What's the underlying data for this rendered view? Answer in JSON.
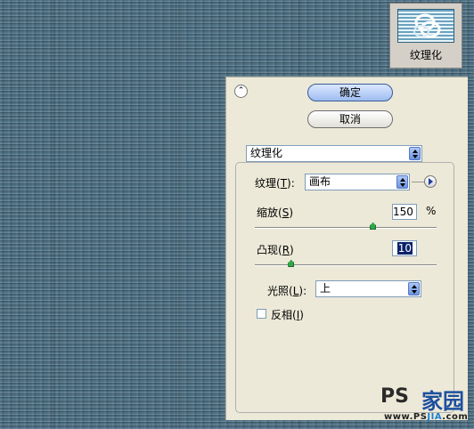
{
  "thumbnail": {
    "label": "纹理化"
  },
  "dialog": {
    "ok_label": "确定",
    "cancel_label": "取消",
    "collapse_glyph": "⌃",
    "filter_select_value": "纹理化",
    "texture": {
      "label": "纹理",
      "hotkey": "T",
      "value": "画布"
    },
    "scale": {
      "label": "缩放",
      "hotkey": "S",
      "value": "150",
      "unit": "%",
      "slider_fraction": 0.65
    },
    "relief": {
      "label": "凸现",
      "hotkey": "R",
      "value": "10",
      "slider_fraction": 0.2
    },
    "light": {
      "label": "光照",
      "hotkey": "L",
      "value": "上"
    },
    "invert": {
      "label": "反相",
      "hotkey": "I",
      "checked": false
    }
  },
  "watermark": {
    "text_left": "PS",
    "text_right": "家园",
    "url_prefix": "www.PS",
    "url_mid": "JIA",
    "url_suffix": ".com"
  },
  "colors": {
    "texture_bg": "#4e7084",
    "panel_bg": "#ece9d8",
    "ok_button": "#9ebcf0",
    "slider_thumb": "#2ea84a"
  }
}
